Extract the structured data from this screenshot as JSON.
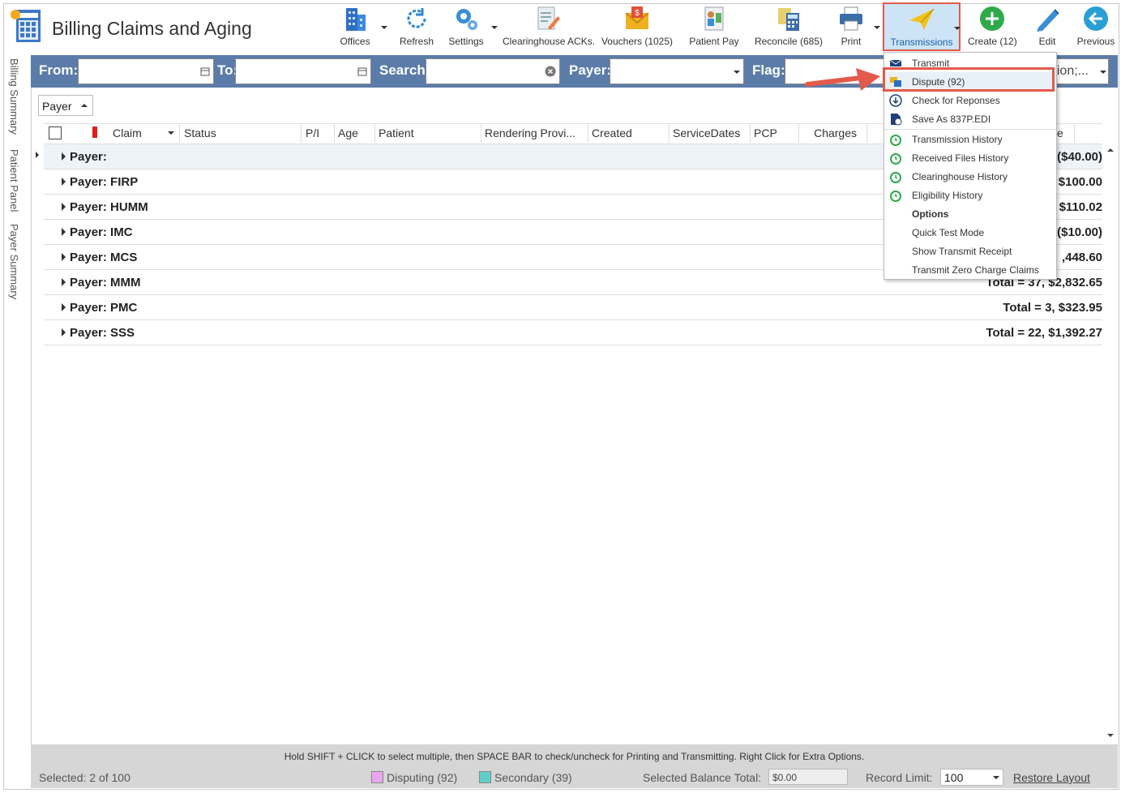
{
  "app": {
    "title": "Billing Claims and Aging"
  },
  "toolbar": {
    "offices": "Offices",
    "refresh": "Refresh",
    "settings": "Settings",
    "clearinghouse_acks": "Clearinghouse ACKs.",
    "vouchers": "Vouchers (1025)",
    "patient_pay": "Patient Pay",
    "reconcile": "Reconcile (685)",
    "print": "Print",
    "transmissions": "Transmissions",
    "create": "Create (12)",
    "edit": "Edit",
    "previous": "Previous"
  },
  "sidebar": {
    "billing_summary": "Billing Summary",
    "patient_panel": "Patient Panel",
    "payer_summary": "Payer Summary"
  },
  "filters": {
    "from_label": "From:",
    "from_value": "",
    "to_label": "To:",
    "to_value": "",
    "search_label": "Search:",
    "search_value": "",
    "payer_label": "Payer:",
    "payer_value": "",
    "flag_label": "Flag:",
    "flag_value_tail": "tion;..."
  },
  "group": {
    "label": "Payer"
  },
  "columns": [
    "Claim",
    "Status",
    "P/I",
    "Age",
    "Patient",
    "Rendering Provi...",
    "Created",
    "ServiceDates",
    "PCP",
    "Charges",
    "e"
  ],
  "rows": [
    {
      "label": "Payer:",
      "total": "($40.00)"
    },
    {
      "label": "Payer: FIRP",
      "total": "$100.00"
    },
    {
      "label": "Payer: HUMM",
      "total": "$110.02"
    },
    {
      "label": "Payer: IMC",
      "total": "($10.00)"
    },
    {
      "label": "Payer: MCS",
      "total": ",448.60"
    },
    {
      "label": "Payer: MMM",
      "total": "Total = 37,  $2,832.65"
    },
    {
      "label": "Payer: PMC",
      "total": "Total = 3,  $323.95"
    },
    {
      "label": "Payer: SSS",
      "total": "Total = 22,  $1,392.27"
    }
  ],
  "menu": {
    "transmit": "Transmit",
    "dispute": "Dispute (92)",
    "check_responses": "Check for Reponses",
    "save_837": "Save As 837P.EDI",
    "transmission_history": "Transmission History",
    "received_files_history": "Received Files History",
    "clearinghouse_history": "Clearinghouse History",
    "eligibility_history": "Eligibility History",
    "options_header": "Options",
    "quick_test_mode": "Quick Test Mode",
    "show_transmit_receipt": "Show Transmit Receipt",
    "transmit_zero_charge": "Transmit Zero Charge Claims"
  },
  "footer": {
    "hint": "Hold SHIFT + CLICK to select multiple, then SPACE BAR to check/uncheck for Printing and Transmitting. Right Click for Extra Options.",
    "selected": "Selected: 2 of 100",
    "disputing": "Disputing (92)",
    "secondary": "Secondary (39)",
    "balance_label": "Selected Balance Total:",
    "balance_value": "$0.00",
    "record_limit_label": "Record Limit:",
    "record_limit_value": "100",
    "restore_layout": "Restore Layout"
  },
  "colors": {
    "accent": "#5b7ca9",
    "highlight": "#e35a4a",
    "disputing": "#e8a6f0",
    "secondary": "#5ecfc8"
  }
}
